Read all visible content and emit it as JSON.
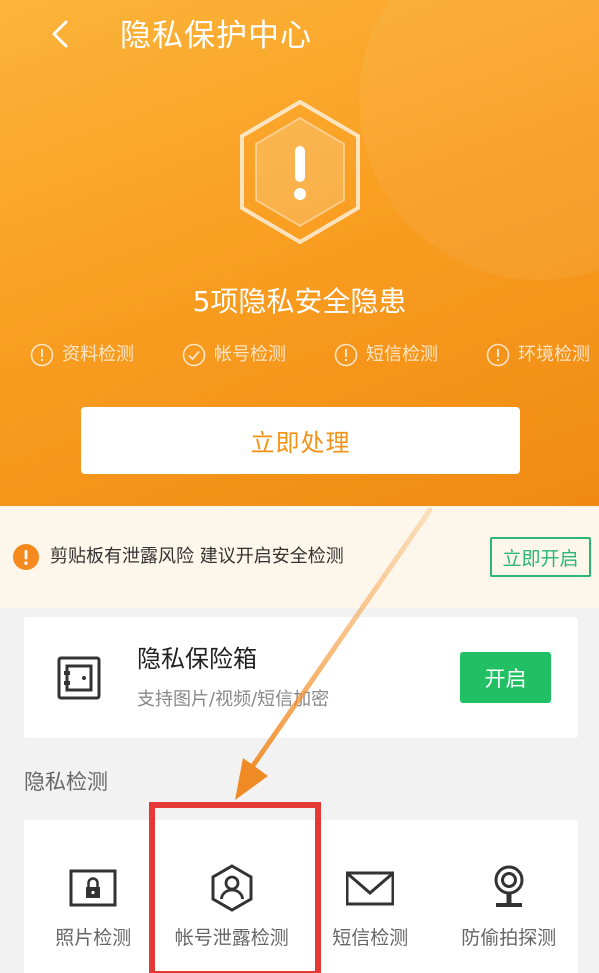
{
  "header": {
    "title": "隐私保护中心",
    "warning_count": "5项隐私安全隐患",
    "checks": [
      {
        "label": "资料检测",
        "icon": "alert-icon"
      },
      {
        "label": "帐号检测",
        "icon": "check-icon"
      },
      {
        "label": "短信检测",
        "icon": "alert-icon"
      },
      {
        "label": "环境检测",
        "icon": "alert-icon"
      }
    ],
    "cta_label": "立即处理"
  },
  "notice": {
    "text": "剪贴板有泄露风险 建议开启安全检测",
    "button_label": "立即开启"
  },
  "vault": {
    "title": "隐私保险箱",
    "subtitle": "支持图片/视频/短信加密",
    "button_label": "开启"
  },
  "section": {
    "title": "隐私检测"
  },
  "grid": {
    "items": [
      {
        "label": "照片检测",
        "icon": "photo-lock-icon"
      },
      {
        "label": "帐号泄露检测",
        "icon": "account-shield-icon"
      },
      {
        "label": "短信检测",
        "icon": "envelope-icon"
      },
      {
        "label": "防偷拍探测",
        "icon": "camera-icon"
      }
    ]
  },
  "colors": {
    "header_orange": "#f99f22",
    "accent_orange": "#f39315",
    "green": "#21c064",
    "highlight_red": "#e53935"
  }
}
